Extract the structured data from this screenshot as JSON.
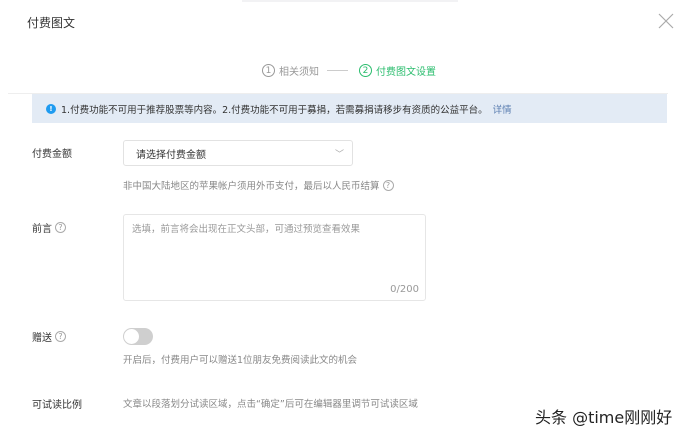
{
  "dialog": {
    "title": "付费图文"
  },
  "steps": [
    {
      "num": "1",
      "label": "相关须知",
      "state": "done"
    },
    {
      "num": "2",
      "label": "付费图文设置",
      "state": "active"
    }
  ],
  "notice": {
    "text": "1.付费功能不可用于推荐股票等内容。2.付费功能不可用于募捐，若需募捐请移步有资质的公益平台。",
    "link": "详情"
  },
  "price": {
    "label": "付费金额",
    "placeholder": "请选择付费金额",
    "hint": "非中国大陆地区的苹果帐户须用外币支付，最后以人民币结算"
  },
  "preface": {
    "label": "前言",
    "placeholder": "选填，前言将会出现在正文头部，可通过预览查看效果",
    "count": "0/200"
  },
  "gift": {
    "label": "赠送",
    "enabled": false,
    "hint": "开启后，付费用户可以赠送1位朋友免费阅读此文的机会"
  },
  "trial": {
    "label": "可试读比例",
    "text": "文章以段落划分试读区域，点击“确定”后可在编辑器里调节可试读区域"
  },
  "watermark": "头条 @time刚刚好",
  "colors": {
    "accent": "#2bbd6e",
    "notice_bg": "#e3ebf5",
    "info": "#1e9bf0"
  }
}
